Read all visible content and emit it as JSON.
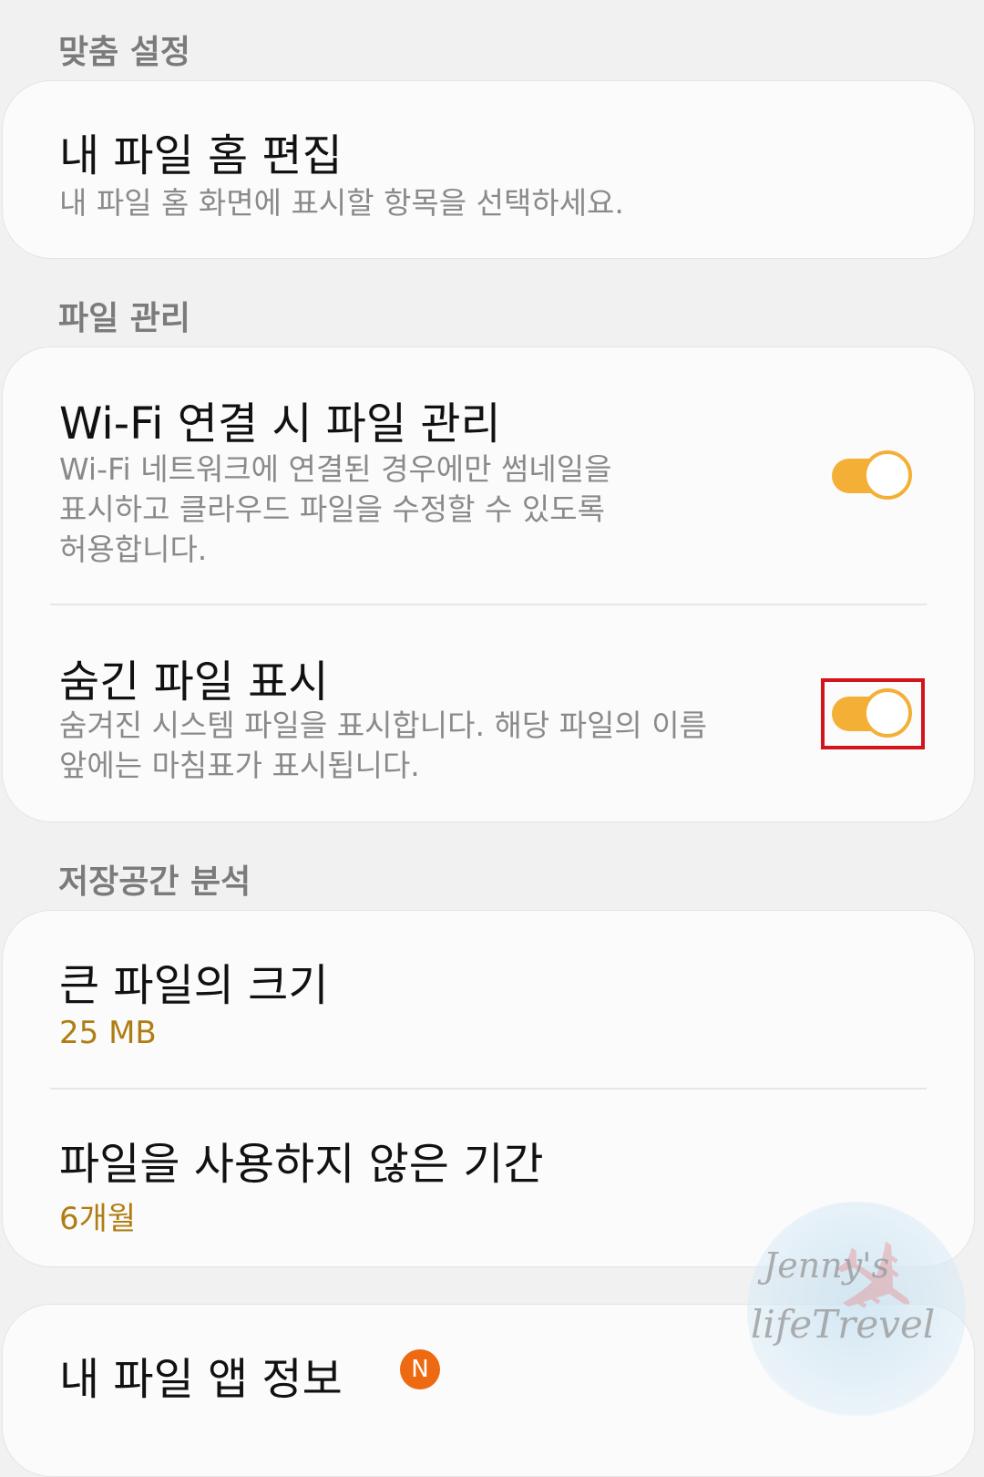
{
  "sections": {
    "custom": {
      "header": "맞춤 설정",
      "item": {
        "title": "내 파일 홈 편집",
        "subtitle": "내 파일 홈 화면에 표시할 항목을 선택하세요."
      }
    },
    "file_management": {
      "header": "파일 관리",
      "wifi": {
        "title": "Wi-Fi 연결 시 파일 관리",
        "subtitle_lines": [
          "Wi-Fi 네트워크에 연결된 경우에만 썸네일을",
          "표시하고 클라우드 파일을 수정할 수 있도록",
          "허용합니다."
        ],
        "enabled": true
      },
      "hidden": {
        "title": "숨긴 파일 표시",
        "subtitle_lines": [
          "숨겨진 시스템 파일을 표시합니다. 해당 파일의 이름",
          "앞에는 마침표가 표시됩니다."
        ],
        "enabled": true
      }
    },
    "storage": {
      "header": "저장공간 분석",
      "large_file": {
        "title": "큰 파일의 크기",
        "value": "25 MB"
      },
      "unused": {
        "title": "파일을 사용하지 않은 기간",
        "value": "6개월"
      }
    },
    "about": {
      "title": "내 파일 앱 정보",
      "badge": "N"
    }
  },
  "watermark": {
    "line1": "Jenny's",
    "line2": "lifeTrevel"
  },
  "colors": {
    "accent": "#f4b036",
    "value_text": "#b07d12",
    "highlight": "#d3141c",
    "badge": "#ee6a12"
  }
}
